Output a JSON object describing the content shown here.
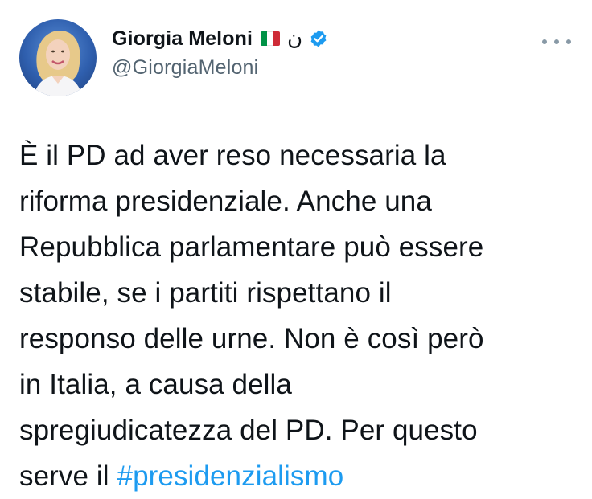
{
  "author": {
    "display_name": "Giorgia Meloni",
    "handle": "@GiorgiaMeloni",
    "arabic_char": "ن",
    "flag_colors": [
      "#009246",
      "#ffffff",
      "#ce2b37"
    ],
    "verified_color": "#1d9bf0",
    "avatar": "profile-photo",
    "flag_icon": "italy-flag-icon",
    "verified_icon": "verified-badge-icon"
  },
  "menu": {
    "icon": "more-options-icon"
  },
  "tweet": {
    "lines": [
      "È il PD ad aver reso necessaria la",
      "riforma presidenziale. Anche una",
      "Repubblica parlamentare può essere",
      "stabile, se i partiti rispettano il",
      "responso delle urne. Non è così però",
      "in Italia, a causa della",
      "spregiudicatezza del PD. Per questo"
    ],
    "last_line_prefix": "serve il ",
    "hashtag": "#presidenzialismo",
    "hashtag_color": "#1d9bf0"
  }
}
